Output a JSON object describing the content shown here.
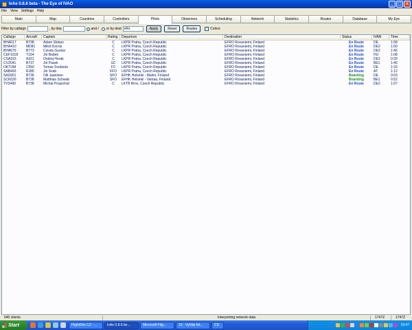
{
  "window": {
    "title": "IvAe 0.8.6 beta - The Eye of IVAO"
  },
  "menu": [
    "File",
    "View",
    "Settings",
    "Help"
  ],
  "tabs": [
    "Main",
    "Map",
    "Countries",
    "Controllers",
    "Pilots",
    "Observers",
    "Scheduling",
    "Network",
    "Statistics",
    "Routes",
    "Database",
    "My Eye"
  ],
  "active_tab": "Pilots",
  "filter": {
    "callsign_label": "Filter by callsign",
    "callsign_value": "",
    "dep_label": ", by dep",
    "dep_value": "",
    "and_label": "and /",
    "or_label": "or by dest",
    "dest_value": "efro",
    "apply": "Apply",
    "reset": "Reset",
    "routes": "Routes",
    "colors": "Colors"
  },
  "table": {
    "headers": [
      "Callsign",
      "Aircraft",
      "Captain",
      "Rating",
      "Departure",
      "Destination",
      "Status",
      "IVAN",
      "Time"
    ],
    "rows": [
      [
        "BHA017",
        "B738",
        "Adam Slokan",
        "C",
        "LKPR Praha, Czech Republic",
        "EFRO Rovaniemi, Finland",
        "En Route",
        "DE",
        "1:58"
      ],
      [
        "BHA410",
        "MD81",
        "Miloš Kornis",
        "C",
        "LKPR Praha, Czech Republic",
        "EFRO Rovaniemi, Finland",
        "En Route",
        "DE2",
        "1:00"
      ],
      [
        "BHA576",
        "B773",
        "Czivás Gustav",
        "C",
        "LKPR Praha, Czech Republic",
        "EFRO Rovaniemi, Finland",
        "En Route",
        "DE2",
        "1:46"
      ],
      [
        "CEF1018",
        "T154",
        "Jiri Bobek",
        "C",
        "LKPR Praha, Czech Republic",
        "EFRO Rovaniemi, Finland",
        "En Route",
        "HU",
        "1:08"
      ],
      [
        "CSA315",
        "A321",
        "Ondrej Horak",
        "C",
        "LKPR Praha, Czech Republic",
        "EFRO Rovaniemi, Finland",
        "En Route",
        "DE2",
        "0:39"
      ],
      [
        "CVZ041",
        "B737",
        "Jiri Pasek",
        "SC",
        "LKPR Praha, Czech Republic",
        "EFRO Rovaniemi, Finland",
        "En Route",
        "BE1",
        "1:45"
      ],
      [
        "OKTOM",
        "C550",
        "Tomas Svoboda",
        "FC",
        "LKPR Praha, Czech Republic",
        "EFRO Rovaniemi, Finland",
        "En Route",
        "DE",
        "1:33"
      ],
      [
        "SAB400",
        "RJ85",
        "Jiri Svab",
        "FFO",
        "LKPR Praha, Czech Republic",
        "EFRO Rovaniemi, Finland",
        "En Route",
        "AT",
        "1:12"
      ],
      [
        "SAS901",
        "B736",
        "Olli Jaaninen",
        "SFO",
        "EFHK Helsinki - Malmi, Finland",
        "EFRO Rovaniemi, Finland",
        "Boarding",
        "DE",
        "0:03"
      ],
      [
        "SCK026",
        "B738",
        "Matthias Schwab",
        "SFO",
        "EFHK Helsinki - Vantaa, Finland",
        "EFRO Rovaniemi, Finland",
        "Boarding",
        "BE1",
        "0:52"
      ],
      [
        "TVS490",
        "B738",
        "Michal Pospíchal",
        "C",
        "LKTB Brno, Czech Republic",
        "EFRO Rovaniemi, Finland",
        "En Route",
        "DE2",
        "1:07"
      ]
    ]
  },
  "statusbar": {
    "clients": "640 clients",
    "message": "Interpreting network data",
    "time1": "1747Z",
    "time2": "1747Z"
  },
  "taskbar": {
    "start": "Start",
    "tasks": [
      "FlightSim.CZ - ...",
      "IvAe 0.8.6 be...",
      "Microsoft Flig...",
      "19 - Vyřída htt...",
      "CS"
    ],
    "clock": "19:47"
  },
  "colors": {
    "status_enroute": "#1f4ad0",
    "status_boarding": "#1c8a1c",
    "titlebar": "#0842c1",
    "taskbar": "#245edb"
  }
}
